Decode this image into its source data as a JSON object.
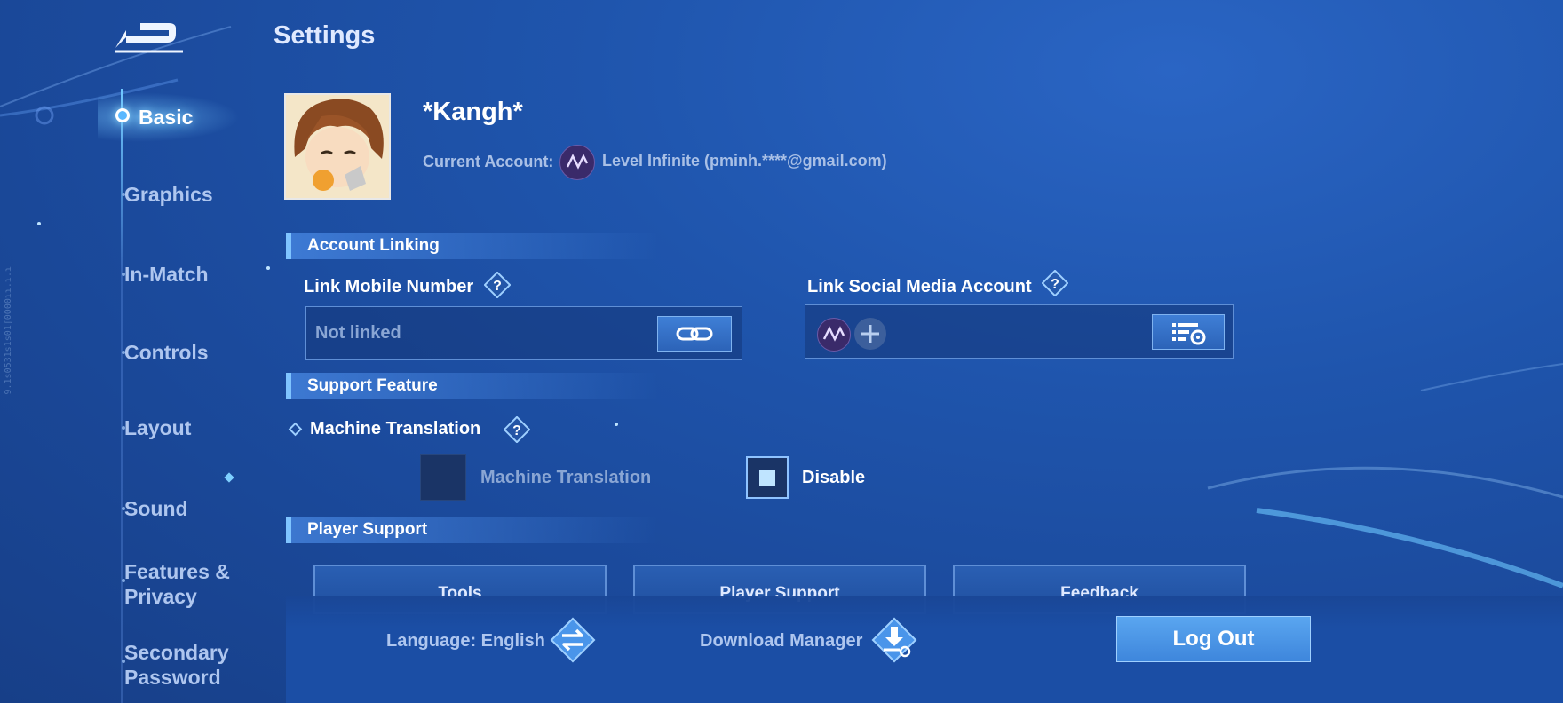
{
  "header": {
    "title": "Settings",
    "back_icon": "back-arrow-icon"
  },
  "sidebar": {
    "items": [
      {
        "label": "Basic",
        "active": true
      },
      {
        "label": "Graphics"
      },
      {
        "label": "In-Match"
      },
      {
        "label": "Controls"
      },
      {
        "label": "Layout"
      },
      {
        "label": "Sound"
      },
      {
        "label": "Features &",
        "label2": "Privacy"
      },
      {
        "label": "Secondary",
        "label2": "Password"
      }
    ]
  },
  "profile": {
    "name": "*Kangh*",
    "account_label": "Current Account:",
    "account_value": "Level Infinite (pminh.****@gmail.com)"
  },
  "account_linking": {
    "title": "Account Linking",
    "mobile_label": "Link Mobile Number",
    "mobile_value": "Not linked",
    "social_label": "Link Social Media Account"
  },
  "support_feature": {
    "title": "Support Feature",
    "machine_translation_label": "Machine Translation",
    "option_off_label": "Machine Translation",
    "option_on_label": "Disable"
  },
  "player_support": {
    "title": "Player Support",
    "buttons": [
      "Tools",
      "Player Support",
      "Feedback"
    ]
  },
  "footer": {
    "language": "Language: English",
    "download_manager": "Download Manager",
    "logout": "Log Out"
  },
  "build_id": "9.1s0531s1s01ʃ0000ɿɿ.ɿ.ɿ",
  "colors": {
    "accent": "#5aa6f0",
    "background": "#1f55ad",
    "text_muted": "#aec6ef"
  }
}
